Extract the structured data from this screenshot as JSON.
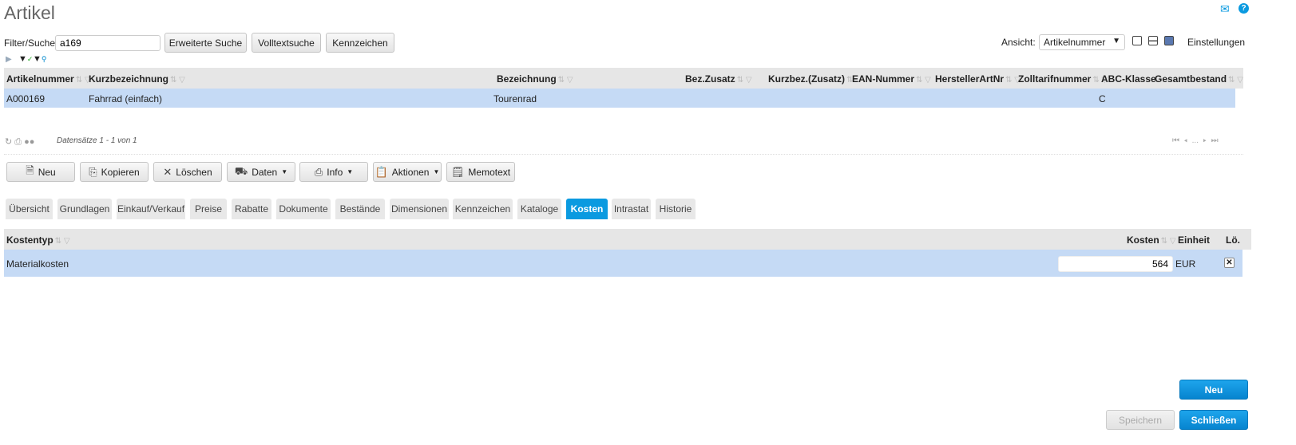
{
  "header": {
    "title": "Artikel",
    "mail_icon": "mail-icon",
    "help_icon": "help-icon"
  },
  "filter": {
    "label": "Filter/Suche:",
    "value": "a169",
    "buttons": [
      "Erweiterte Suche",
      "Volltextsuche",
      "Kennzeichen"
    ]
  },
  "view": {
    "label": "Ansicht:",
    "selected": "Artikelnummer",
    "settings": "Einstellungen"
  },
  "grid": {
    "columns": [
      "Artikelnummer",
      "Kurzbezeichnung",
      "Bezeichnung",
      "Bez.Zusatz",
      "Kurzbez.(Zusatz)",
      "EAN-Nummer",
      "HerstellerArtNr",
      "Zolltarifnummer",
      "ABC-Klasse",
      "Gesamtbestand"
    ],
    "rows": [
      {
        "artikelnummer": "A000169",
        "kurzbezeichnung": "Fahrrad (einfach)",
        "bezeichnung": "Tourenrad",
        "abc": "C"
      }
    ],
    "records": "Datensätze 1 - 1 von 1",
    "pager_ellipsis": "..."
  },
  "actions": [
    "Neu",
    "Kopieren",
    "Löschen",
    "Daten",
    "Info",
    "Aktionen",
    "Memotext"
  ],
  "tabs": [
    "Übersicht",
    "Grundlagen",
    "Einkauf/Verkauf",
    "Preise",
    "Rabatte",
    "Dokumente",
    "Bestände",
    "Dimensionen",
    "Kennzeichen",
    "Kataloge",
    "Kosten",
    "Intrastat",
    "Historie"
  ],
  "active_tab": "Kosten",
  "costs": {
    "columns": [
      "Kostentyp",
      "Kosten",
      "Einheit",
      "Lö."
    ],
    "rows": [
      {
        "typ": "Materialkosten",
        "kosten": "564",
        "einheit": "EUR"
      }
    ]
  },
  "footer": {
    "new": "Neu",
    "save": "Speichern",
    "close": "Schließen"
  },
  "colors": {
    "accent": "#0a9ae0",
    "row_selected": "#c5daf5",
    "header_bg": "#e6e6e6"
  }
}
